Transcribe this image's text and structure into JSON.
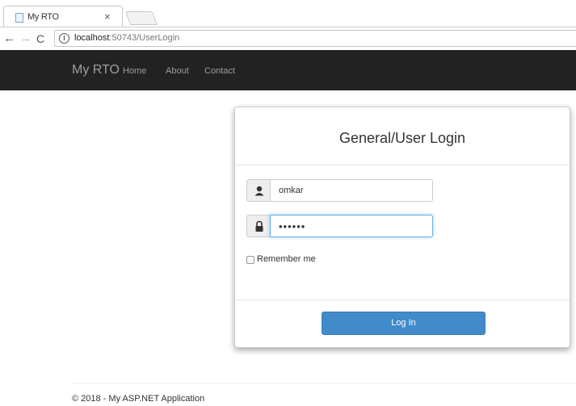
{
  "browser": {
    "tab_title": "My RTO",
    "tab_close": "×",
    "url_host": "localhost",
    "url_path": ":50743/UserLogin",
    "back": "←",
    "forward": "→",
    "reload": "C",
    "info": "i"
  },
  "navbar": {
    "brand": "My RTO",
    "links": [
      "Home",
      "About",
      "Contact"
    ],
    "background": "#222222"
  },
  "login": {
    "title": "General/User Login",
    "username_value": "omkar",
    "password_value": "••••••",
    "remember_label": "Remember me",
    "remember_checked": false,
    "button_label": "Log In",
    "button_color": "#428bca"
  },
  "footer": {
    "text": "© 2018 - My ASP.NET Application"
  }
}
